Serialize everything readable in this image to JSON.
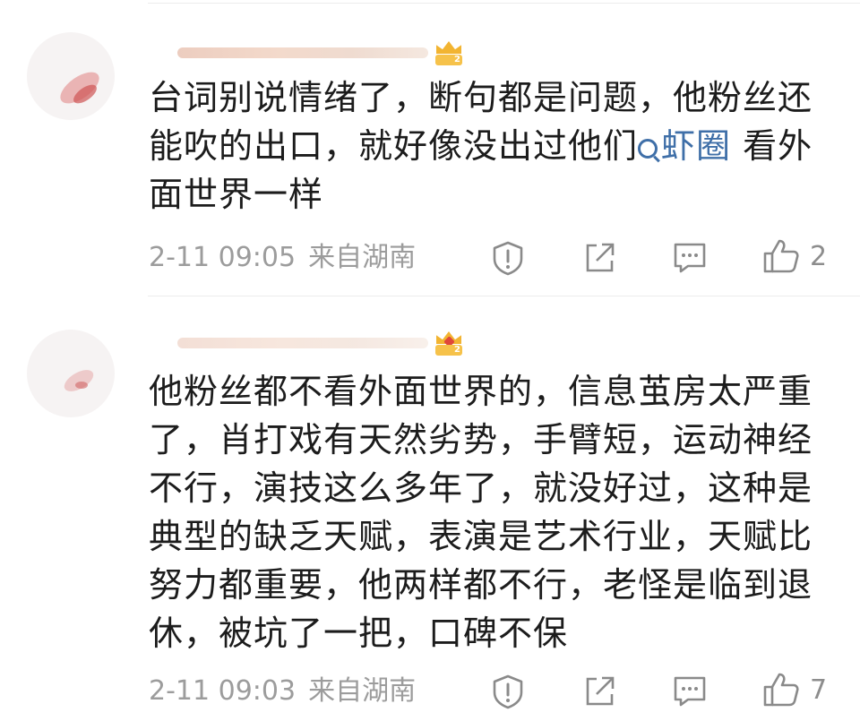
{
  "comments": [
    {
      "text_before_link": "台词别说情绪了，断句都是问题，他粉丝还能吹的出口，就好像没出过他们",
      "topic_link": "虾圈",
      "text_after_link": " 看外面世界一样",
      "date": "2-11 09:05",
      "source": "来自湖南",
      "likes": "2"
    },
    {
      "text": "他粉丝都不看外面世界的，信息茧房太严重了，肖打戏有天然劣势，手臂短，运动神经不行，演技这么多年了，就没好过，这种是典型的缺乏天赋，表演是艺术行业，天赋比努力都重要，他两样都不行，老怪是临到退休，被坑了一把，口碑不保",
      "date": "2-11 09:03",
      "source": "来自湖南",
      "likes": "7"
    }
  ],
  "colors": {
    "link": "#3f6fa8",
    "meta": "#9c9c9c",
    "icon": "#8a8a8a",
    "badge": "#f2b431"
  }
}
